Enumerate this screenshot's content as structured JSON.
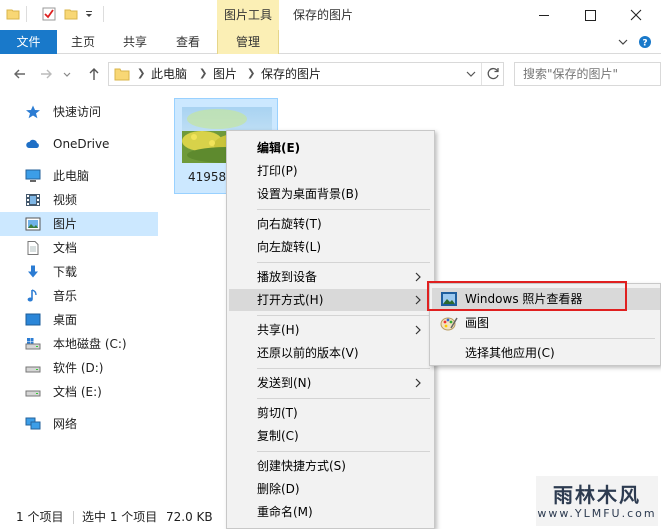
{
  "window": {
    "contextual_tab_group": "图片工具",
    "title": "保存的图片"
  },
  "ribbon": {
    "tabs": [
      "文件",
      "主页",
      "共享",
      "查看",
      "管理"
    ]
  },
  "address": {
    "breadcrumbs": [
      "此电脑",
      "图片",
      "保存的图片"
    ],
    "search_placeholder": "搜索\"保存的图片\""
  },
  "sidebar": {
    "items": [
      {
        "label": "快速访问",
        "icon": "star-icon"
      },
      {
        "label": "OneDrive",
        "icon": "cloud-icon"
      },
      {
        "label": "此电脑",
        "icon": "computer-icon"
      },
      {
        "label": "视频",
        "icon": "video-icon"
      },
      {
        "label": "图片",
        "icon": "pictures-icon",
        "selected": true
      },
      {
        "label": "文档",
        "icon": "documents-icon"
      },
      {
        "label": "下载",
        "icon": "download-icon"
      },
      {
        "label": "音乐",
        "icon": "music-icon"
      },
      {
        "label": "桌面",
        "icon": "desktop-icon"
      },
      {
        "label": "本地磁盘 (C:)",
        "icon": "drive-icon"
      },
      {
        "label": "软件 (D:)",
        "icon": "drive-icon"
      },
      {
        "label": "文档 (E:)",
        "icon": "drive-icon"
      },
      {
        "label": "网络",
        "icon": "network-icon"
      }
    ]
  },
  "file": {
    "name": "41958"
  },
  "status": {
    "count": "1 个项目",
    "selected": "选中 1 个项目",
    "size": "72.0 KB"
  },
  "context_menu": {
    "items": [
      {
        "label": "编辑(E)",
        "bold": true
      },
      {
        "label": "打印(P)"
      },
      {
        "label": "设置为桌面背景(B)"
      },
      {
        "label": "向右旋转(T)"
      },
      {
        "label": "向左旋转(L)"
      },
      {
        "label": "播放到设备",
        "submenu": true
      },
      {
        "label": "打开方式(H)",
        "submenu": true,
        "highlighted": true
      },
      {
        "label": "共享(H)",
        "submenu": true
      },
      {
        "label": "还原以前的版本(V)"
      },
      {
        "label": "发送到(N)",
        "submenu": true
      },
      {
        "label": "剪切(T)"
      },
      {
        "label": "复制(C)"
      },
      {
        "label": "创建快捷方式(S)"
      },
      {
        "label": "删除(D)"
      },
      {
        "label": "重命名(M)"
      }
    ]
  },
  "open_with_submenu": {
    "items": [
      {
        "label": "Windows 照片查看器",
        "icon": "photo-viewer-icon",
        "highlighted": true
      },
      {
        "label": "画图",
        "icon": "paint-icon"
      },
      {
        "label": "选择其他应用(C)"
      }
    ]
  },
  "watermark": {
    "title": "雨林木风",
    "url": "www.YLMFU.com"
  },
  "colors": {
    "accent": "#1979ca",
    "selection": "#cce8ff",
    "contextual_tab": "#fbefb5",
    "highlight_box": "#e02020"
  }
}
